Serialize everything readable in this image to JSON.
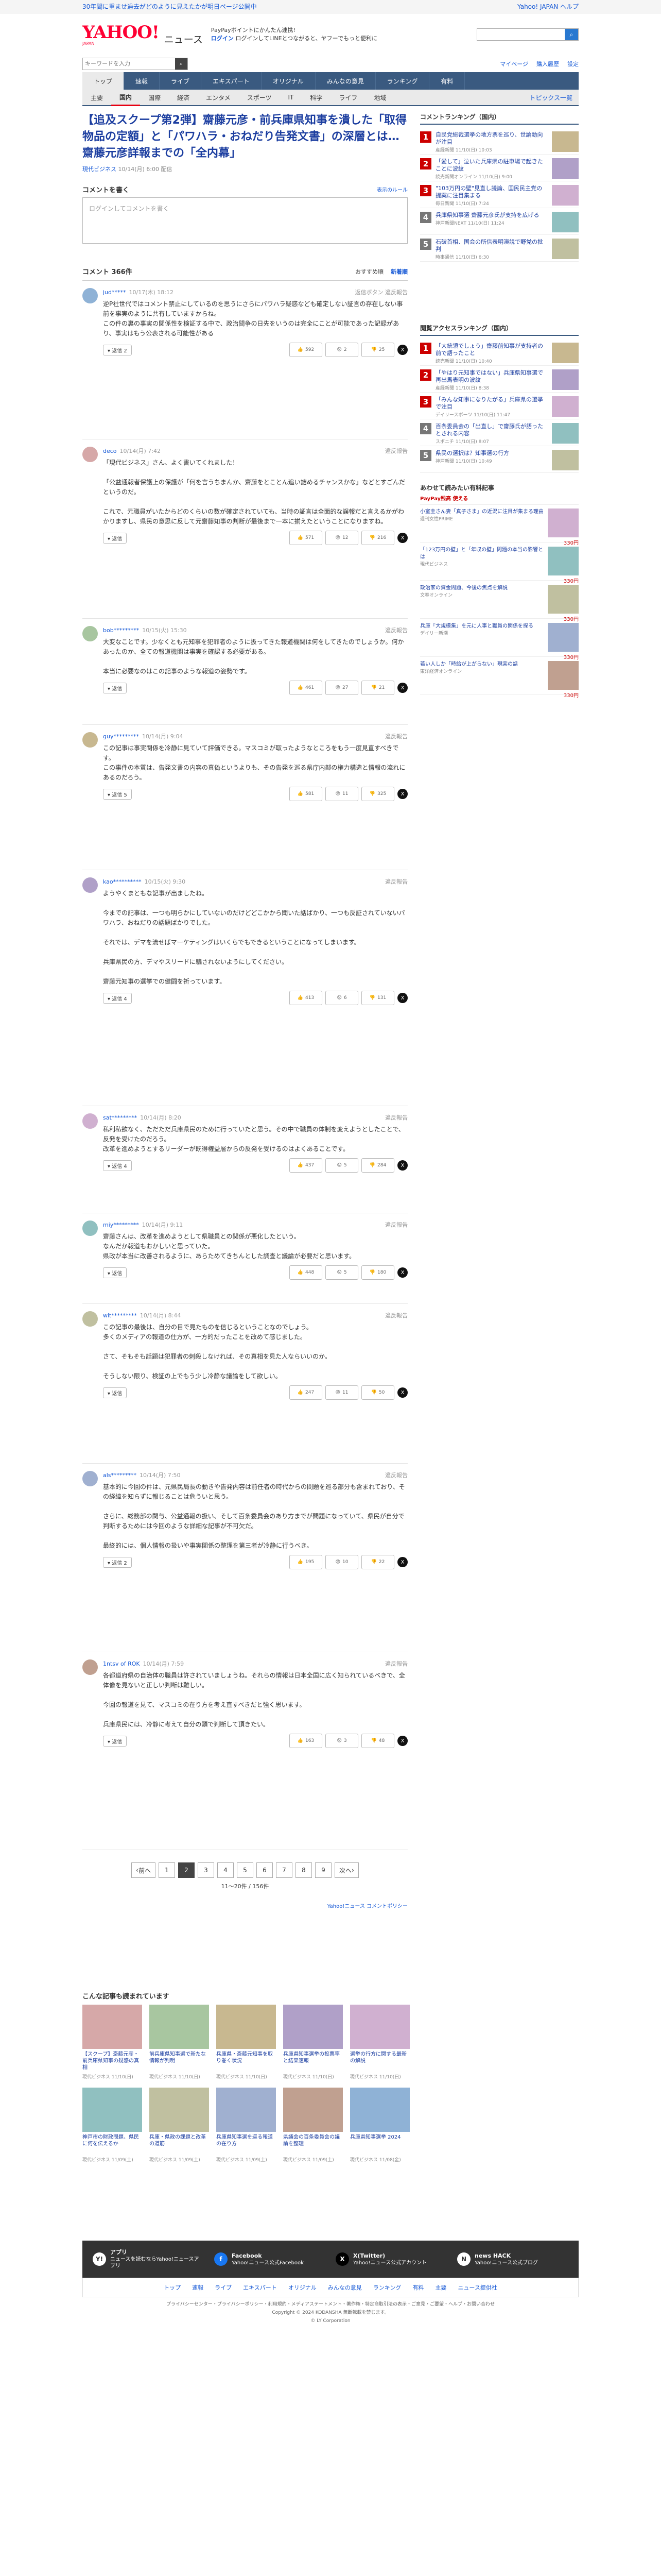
{
  "banner": {
    "left": "30年間に重ませ過去がどのように見えたかが明日ページ公開中",
    "right": "Yahoo! JAPAN ヘルプ"
  },
  "header": {
    "logo": "YAHOO!",
    "logo_sub": "JAPAN",
    "section": "ニュース",
    "promo_1": "PayPayポイントにかんたん連携!",
    "promo_2": "ログインしてLINEとつながると、ヤフーでもっと便利に",
    "search_placeholder": "",
    "login_label": "ログイン",
    "login_promo": "LINEでつながるともっと便利"
  },
  "subbar": {
    "search_placeholder": "キーワードを入力",
    "links": [
      "マイページ",
      "購入履歴",
      "設定"
    ]
  },
  "gnav": [
    "トップ",
    "速報",
    "ライブ",
    "エキスパート",
    "オリジナル",
    "みんなの意見",
    "ランキング",
    "有料"
  ],
  "snav": [
    "主要",
    "国内",
    "国際",
    "経済",
    "エンタメ",
    "スポーツ",
    "IT",
    "科学",
    "ライフ",
    "地域"
  ],
  "snav_right": "トピックス一覧",
  "article": {
    "title": "【追及スクープ第2弾】齋藤元彦・前兵庫県知事を潰した「取得物品の定額」と「パワハラ・おねだり告発文書」の深層とは…齋藤元彦詳報までの「全内幕」",
    "source": "現代ビジネス",
    "date": "10/14(月) 6:00 配信"
  },
  "comment_post": {
    "heading": "コメントを書く",
    "help": "表示のルール",
    "placeholder": "ログインしてコメントを書く"
  },
  "comments_header": {
    "label": "コメント 366件",
    "sort_label": "おすすめ順",
    "sort_new": "新着順"
  },
  "comments": [
    {
      "user": "jud*****",
      "time": "10/17(木) 18:12",
      "rep": "返信ボタン 違反報告",
      "text": "逆P社世代ではコメント禁止にしているのを思うにさらにパワハラ疑惑なども確定しない証言の存在しない事前を事実のように共有していますからね。\nこの件の裏の事実の関係性を検証する中で、政治闘争の日先をいうのは完全にことが可能であった記録があり、事実はもう公表される可能性がある",
      "n": "2",
      "up": "592",
      "mid": "2",
      "down": "25",
      "h": "308"
    },
    {
      "user": "deco",
      "time": "10/14(月) 7:42",
      "rep": "違反報告",
      "text": "「現代ビジネス」さん、よく書いてくれました！\n\n「公益通報者保護上の保護が「何を言うちまんか、齋藤をとことん追い詰めるチャンスかな」などとすごんだというのだ。\n\nこれで、元職員がいたからどのくらいの数が確定されていても、当時の証言は全面的な誤報だと言えるかがわかりますし、県民の意思に反して元齋藤知事の判断が最後まで一本に揃えたということになりますね。",
      "n": "",
      "up": "571",
      "mid": "12",
      "down": "216",
      "h": "348"
    },
    {
      "user": "bob*********",
      "time": "10/15(火) 15:30",
      "rep": "違反報告",
      "text": "大変なことです。少なくとも元知事を犯罪者のように扱ってきた報道機関は何をしてきたのでしょうか。何かあったのか、全ての報道機関は事実を確認する必要がある。\n\n本当に必要なのはこの記事のような報道の姿勢です。",
      "n": "",
      "up": "461",
      "mid": "27",
      "down": "21",
      "h": "206"
    },
    {
      "user": "guy*********",
      "time": "10/14(月) 9:04",
      "rep": "違反報告",
      "text": "この記事は事実関係を冷静に見ていて評価できる。マスコミが取ったようなところをもう一度見直すべきです。\nこの事件の本質は、告発文書の内容の真偽というよりも、その告発を巡る県庁内部の権力構造と情報の流れにあるのだろう。",
      "n": "5",
      "up": "581",
      "mid": "11",
      "down": "325",
      "h": "282"
    },
    {
      "user": "kao**********",
      "time": "10/15(火) 9:30",
      "rep": "違反報告",
      "text": "ようやくまともな記事が出ましたね。\n\n今までの記事は、一つも明らかにしていないのだけどどこかから聞いた話ばかり、一つも反証されていないパワハラ、おねだりの話題ばかりでした。\n\nそれでは、デマを流せばマーケティングはいくらでもできるということになってしまいます。\n\n兵庫県民の方、デマやスリードに騙されないようにしてください。\n\n齋藤元知事の選挙での健闘を祈っています。",
      "n": "4",
      "up": "413",
      "mid": "6",
      "down": "131",
      "h": "458"
    },
    {
      "user": "sat*********",
      "time": "10/14(月) 8:20",
      "rep": "違反報告",
      "text": "私利私欲なく、ただただ兵庫県民のために行っていたと思う。その中で職員の体制を変えようとしたことで、反発を受けたのだろう。\n改革を進めようとするリーダーが既得権益層からの反発を受けるのはよくあることです。",
      "n": "4",
      "up": "437",
      "mid": "5",
      "down": "284",
      "h": "208"
    },
    {
      "user": "miy*********",
      "time": "10/14(月) 9:11",
      "rep": "違反報告",
      "text": "齋藤さんは、改革を進めようとして県職員との関係が悪化したという。\nなんだか報道もおかしいと思っていた。\n県政が本当に改善されるように、あらためてきちんとした調査と議論が必要だと思います。",
      "n": "",
      "up": "448",
      "mid": "5",
      "down": "180",
      "h": "176"
    },
    {
      "user": "wit*********",
      "time": "10/14(月) 8:44",
      "rep": "違反報告",
      "text": "この記事の最後は、自分の目で見たものを信じるということなのでしょう。\n多くのメディアの報道の仕方が、一方的だったことを改めて感じました。\n\nさて、そもそも話題は犯罪者の刺殺しなければ、その真相を見た人ならいいのか。\n\nそうしない限り、検証の上でもう少し冷静な議論をして欲しい。",
      "n": "",
      "up": "247",
      "mid": "11",
      "down": "50",
      "h": "310"
    },
    {
      "user": "als*********",
      "time": "10/14(月) 7:50",
      "rep": "違反報告",
      "text": "基本的に今回の件は、元県民局長の動きや告発内容は前任者の時代からの問題を巡る部分も含まれており、その経緯を知らずに報じることは危ういと思う。\n\nさらに、総務部の関与、公益通報の扱い、そして百条委員会のあり方までが問題になっていて、県民が自分で判断するためには今回のような詳細な記事が不可欠だ。\n\n最終的には、個人情報の扱いや事実関係の整理を第三者が冷静に行うべき。",
      "n": "2",
      "up": "195",
      "mid": "10",
      "down": "22",
      "h": "366"
    },
    {
      "user": "1ntsv of ROK",
      "time": "10/14(月) 7:59",
      "rep": "違反報告",
      "text": "各都道府県の自治体の職員は許されていましょうね。それらの情報は日本全国に広く知られているべきで、全体像を見ないと正しい判断は難しい。\n\n今回の報道を見て、マスコミの在り方を考え直すべきだと強く思います。\n\n兵庫県民には、冷静に考えて自分の頭で判断して頂きたい。",
      "n": "",
      "up": "163",
      "mid": "3",
      "down": "48",
      "h": "384"
    }
  ],
  "pager": {
    "prev": "前へ",
    "next": "次へ",
    "pages": [
      "1",
      "2",
      "3",
      "4",
      "5",
      "6",
      "7",
      "8",
      "9"
    ],
    "current": "2",
    "count": "11〜20件 / 156件"
  },
  "comment_link": "Yahoo!ニュース コメントポリシー",
  "ranking": {
    "title": "コメントランキング（国内）",
    "items": [
      {
        "n": "1",
        "t": "自民党総裁選挙の地方票を巡り、世論動向が注目",
        "m": "産経新聞 11/10(日) 10:03"
      },
      {
        "n": "2",
        "t": "「愛して」泣いた兵庫県の駐車場で起きたことに波紋",
        "m": "読売新聞オンライン 11/10(日) 9:00"
      },
      {
        "n": "3",
        "t": "\"103万円の壁\"見直し議論、国民民主党の提案に注目集まる",
        "m": "毎日新聞 11/10(日) 7:24"
      },
      {
        "n": "4",
        "t": "兵庫県知事選 齋藤元彦氏が支持を広げる",
        "m": "神戸新聞NEXT 11/10(日) 11:24"
      },
      {
        "n": "5",
        "t": "石破首相、国会の所信表明演説で野党の批判",
        "m": "時事通信 11/10(日) 6:30"
      }
    ]
  },
  "access": {
    "title": "閲覧アクセスランキング（国内）",
    "items": [
      {
        "n": "1",
        "t": "「大統領でしょう」齋藤前知事が支持者の前で語ったこと",
        "m": "読売新聞 11/10(日) 10:40"
      },
      {
        "n": "2",
        "t": "「やはり元知事ではない」兵庫県知事選で再出馬表明の波紋",
        "m": "産経新聞 11/10(日) 8:38"
      },
      {
        "n": "3",
        "t": "「みんな知事になりたがる」兵庫県の選挙で注目",
        "m": "デイリースポーツ 11/10(日) 11:47"
      },
      {
        "n": "4",
        "t": "百条委員会の「出直し」で齋藤氏が語ったとされる内容",
        "m": "スポニチ 11/10(日) 8:07"
      },
      {
        "n": "5",
        "t": "県民の選択は？知事選の行方",
        "m": "神戸新聞 11/10(日) 10:49"
      }
    ]
  },
  "ads": {
    "title": "あわせて読みたい有料記事",
    "badge": "PayPay残高 使える",
    "items": [
      {
        "t": "小室圭さん妻「真子さま」の近況に注目が集まる理由",
        "m": "週刊女性PRIME",
        "p": "330円"
      },
      {
        "t": "「123万円の壁」と「年収の壁」問題の本当の影響とは",
        "m": "現代ビジネス",
        "p": "330円"
      },
      {
        "t": "政治家の資金問題、今後の焦点を解説",
        "m": "文春オンライン",
        "p": "330円"
      },
      {
        "t": "兵庫「大規模集」を元に人事と職員の関係を探る",
        "m": "デイリー新潮",
        "p": "330円"
      },
      {
        "t": "若い人しか「時給が上がらない」現実の話",
        "m": "東洋経済オンライン",
        "p": "330円"
      }
    ]
  },
  "related": {
    "title": "こんな記事も読まれています",
    "items": [
      {
        "t": "【スクープ】斎藤元彦・前兵庫県知事の疑惑の真相",
        "m": "現代ビジネス 11/10(日)"
      },
      {
        "t": "前兵庫県知事選で新たな情報が判明",
        "m": "現代ビジネス 11/10(日)"
      },
      {
        "t": "兵庫県・斎藤元知事を取り巻く状況",
        "m": "現代ビジネス 11/10(日)"
      },
      {
        "t": "兵庫県知事選挙の投票率と結果速報",
        "m": "現代ビジネス 11/10(日)"
      },
      {
        "t": "選挙の行方に関する最新の解説",
        "m": "現代ビジネス 11/10(日)"
      },
      {
        "t": "神戸市の財政問題、県民に何を伝えるか",
        "m": "現代ビジネス 11/09(土)"
      },
      {
        "t": "兵庫・県政の課題と改革の道筋",
        "m": "現代ビジネス 11/09(土)"
      },
      {
        "t": "兵庫県知事選を巡る報道の在り方",
        "m": "現代ビジネス 11/09(土)"
      },
      {
        "t": "県議会の百条委員会の議論を整理",
        "m": "現代ビジネス 11/09(土)"
      },
      {
        "t": "兵庫県知事選挙 2024",
        "m": "現代ビジネス 11/08(金)"
      }
    ]
  },
  "footer": {
    "boxes": [
      {
        "h": "アプリ",
        "s": "ニュースを読むならYahoo!ニュースアプリ"
      },
      {
        "h": "Facebook",
        "s": "Yahoo!ニュース公式Facebook"
      },
      {
        "h": "X(Twitter)",
        "s": "Yahoo!ニュース公式アカウント"
      },
      {
        "h": "news HACK",
        "s": "Yahoo!ニュース公式ブログ"
      }
    ],
    "nav": [
      "トップ",
      "速報",
      "ライブ",
      "エキスパート",
      "オリジナル",
      "みんなの意見",
      "ランキング",
      "有料",
      "主要",
      "ニュース提供社"
    ],
    "line1": "プライバシーセンター・プライバシーポリシー・利用規約・メディアステートメント・著作権・特定商取引法の表示・ご意見・ご要望・ヘルプ・お問い合わせ",
    "copyright": "Copyright © 2024 KODANSHA 無断転載を禁じます。",
    "corp": "© LY Corporation"
  }
}
